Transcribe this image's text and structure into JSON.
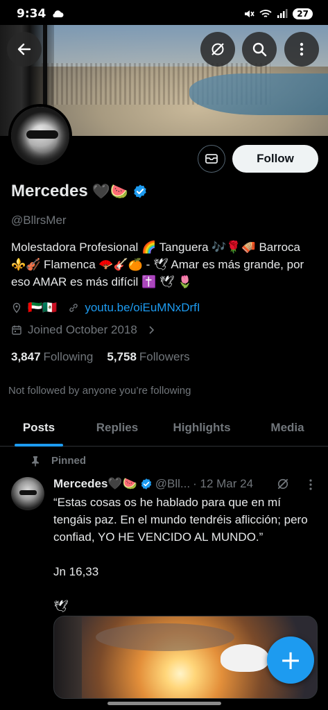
{
  "status_bar": {
    "time": "9:34",
    "battery": "27"
  },
  "header": {
    "back_label": "Back"
  },
  "profile": {
    "display_name": "Mercedes",
    "name_emojis": "🖤🍉",
    "handle": "@BllrsMer",
    "bio": "Molestadora Profesional 🌈 Tanguera 🎶🌹🪗 Barroca ⚜️🎻 Flamenca 🪭🎸🍊 - 🕊 Amar es más grande, por eso AMAR es más difícil ✝️ 🕊 🌷",
    "location_flags": "🇦🇪🇲🇽",
    "website": "youtu.be/oiEuMNxDrfI",
    "joined": "Joined October 2018",
    "following_count": "3,847",
    "following_label": "Following",
    "followers_count": "5,758",
    "followers_label": "Followers",
    "not_followed": "Not followed by anyone you’re following",
    "follow_label": "Follow"
  },
  "tabs": [
    {
      "label": "Posts"
    },
    {
      "label": "Replies"
    },
    {
      "label": "Highlights"
    },
    {
      "label": "Media"
    }
  ],
  "pinned_tweet": {
    "pinned_label": "Pinned",
    "name": "Mercedes🖤🍉",
    "handle": "@Bll...",
    "date": "· 12 Mar 24",
    "text": "“Estas cosas os he hablado para que en mí tengáis paz. En el mundo tendréis aflicción; pero confiad, YO HE VENCIDO AL MUNDO.”\n\nJn 16,33\n\n🕊"
  },
  "fab_label": "+",
  "colors": {
    "accent": "#1d9bf0",
    "background": "#000000",
    "muted": "#71767b"
  }
}
